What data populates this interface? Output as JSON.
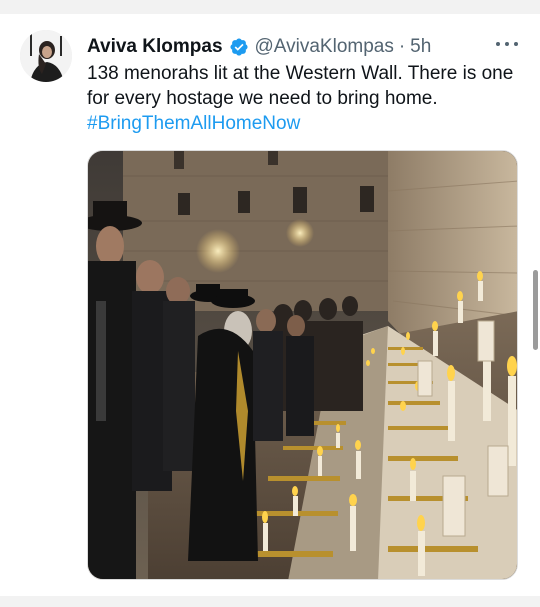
{
  "tweet": {
    "display_name": "Aviva Klompas",
    "handle": "@AvivaKlompas",
    "separator": "·",
    "time": "5h",
    "text_line1": "138 menorahs lit at the Western Wall. There is one",
    "text_line2": "for every hostage we need to bring home.",
    "hashtag": "#BringThemAllHomeNow"
  },
  "icons": {
    "verified": "verified-badge-icon",
    "more": "more-options-icon"
  },
  "colors": {
    "accent": "#1d9bf0",
    "text": "#0f1419",
    "secondary": "#536471"
  }
}
